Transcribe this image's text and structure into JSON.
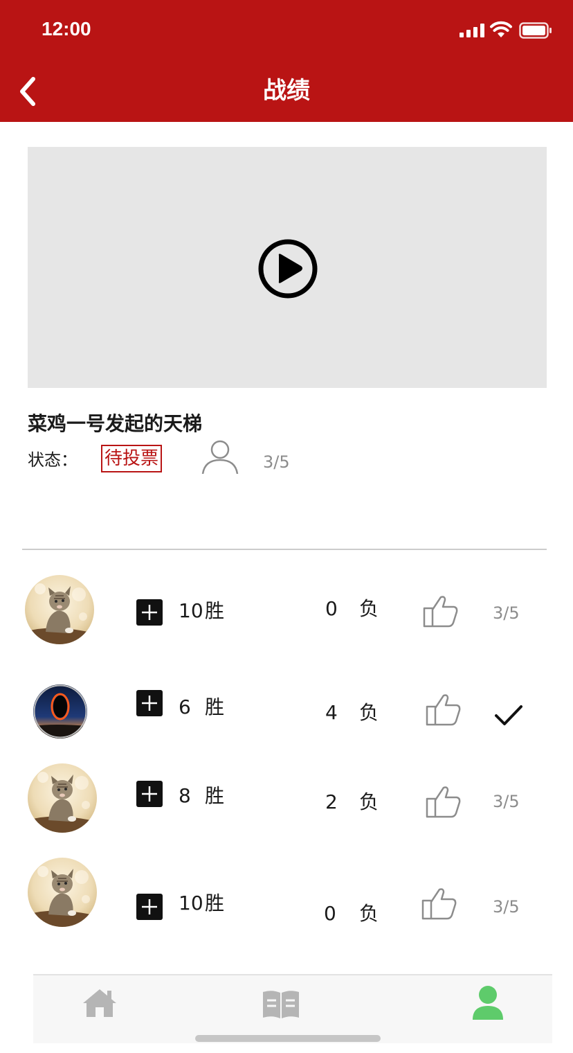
{
  "status_bar": {
    "time": "12:00"
  },
  "header": {
    "title": "战绩"
  },
  "ladder": {
    "title": "菜鸡一号发起的天梯",
    "status_label": "状态：",
    "status_value": "待投票",
    "vote_count": "3/5"
  },
  "players": [
    {
      "avatar": "cat-avatar",
      "wins": "10",
      "win_label": "胜",
      "losses": "0",
      "loss_label": "负",
      "votes": "3/5",
      "voted": false
    },
    {
      "avatar": "eclipse-avatar",
      "wins": "6",
      "win_label": "胜",
      "losses": "4",
      "loss_label": "负",
      "votes": "",
      "voted": true
    },
    {
      "avatar": "cat-avatar",
      "wins": "8",
      "win_label": "胜",
      "losses": "2",
      "loss_label": "负",
      "votes": "3/5",
      "voted": false
    },
    {
      "avatar": "cat-avatar",
      "wins": "10",
      "win_label": "胜",
      "losses": "0",
      "loss_label": "负",
      "votes": "3/5",
      "voted": false
    }
  ],
  "tabbar": {
    "items": [
      {
        "icon": "home-icon",
        "active": false
      },
      {
        "icon": "book-icon",
        "active": false
      },
      {
        "icon": "user-icon",
        "active": true
      }
    ]
  },
  "colors": {
    "brand": "#b91414",
    "active_tab": "#5ecb6b",
    "inactive_tab": "#b5b5b5",
    "muted_text": "#8c8c8c"
  }
}
